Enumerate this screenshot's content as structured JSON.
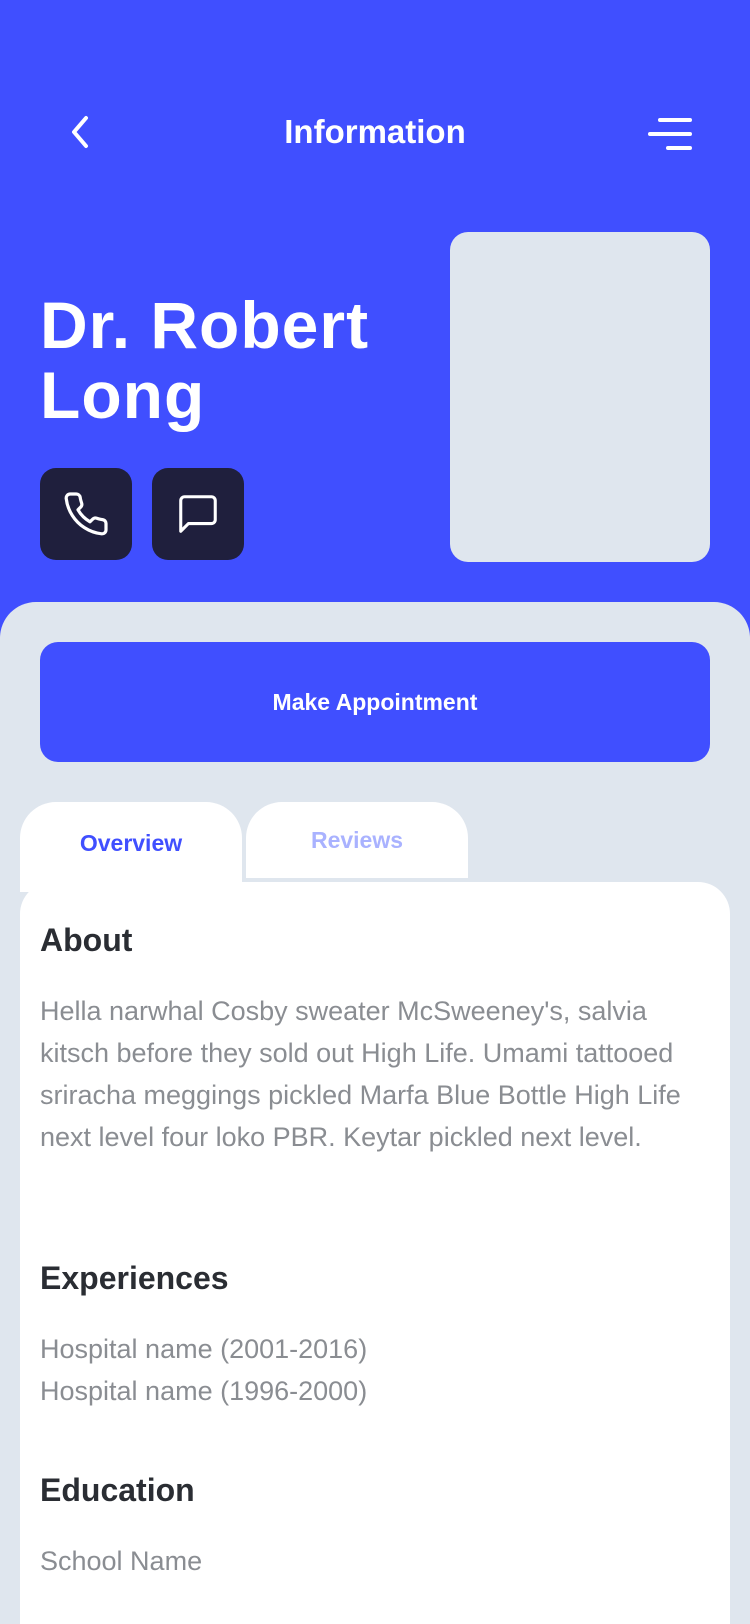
{
  "header": {
    "title": "Information",
    "doctor_name": "Dr. Robert Long"
  },
  "icons": {
    "back": "chevron-left",
    "menu": "hamburger-menu",
    "call": "phone",
    "message": "chat-bubble"
  },
  "actions": {
    "appointment_label": "Make Appointment"
  },
  "tabs": [
    {
      "label": "Overview",
      "active": true
    },
    {
      "label": "Reviews",
      "active": false
    }
  ],
  "about": {
    "title": "About",
    "text": "Hella narwhal Cosby sweater McSweeney's, salvia kitsch before they sold out High Life. Umami tattooed sriracha meggings pickled Marfa Blue Bottle High Life next level four loko PBR. Keytar pickled next level."
  },
  "experiences": {
    "title": "Experiences",
    "items": [
      "Hospital name (2001-2016)",
      "Hospital name (1996-2000)"
    ]
  },
  "education": {
    "title": "Education",
    "items": [
      "School Name"
    ]
  },
  "colors": {
    "primary": "#404fff",
    "dark_button": "#1f1f3d",
    "background": "#dfe6ee",
    "heading": "#2a2d33",
    "body_text": "#8a8d92",
    "inactive_tab": "#a9b2ff"
  }
}
